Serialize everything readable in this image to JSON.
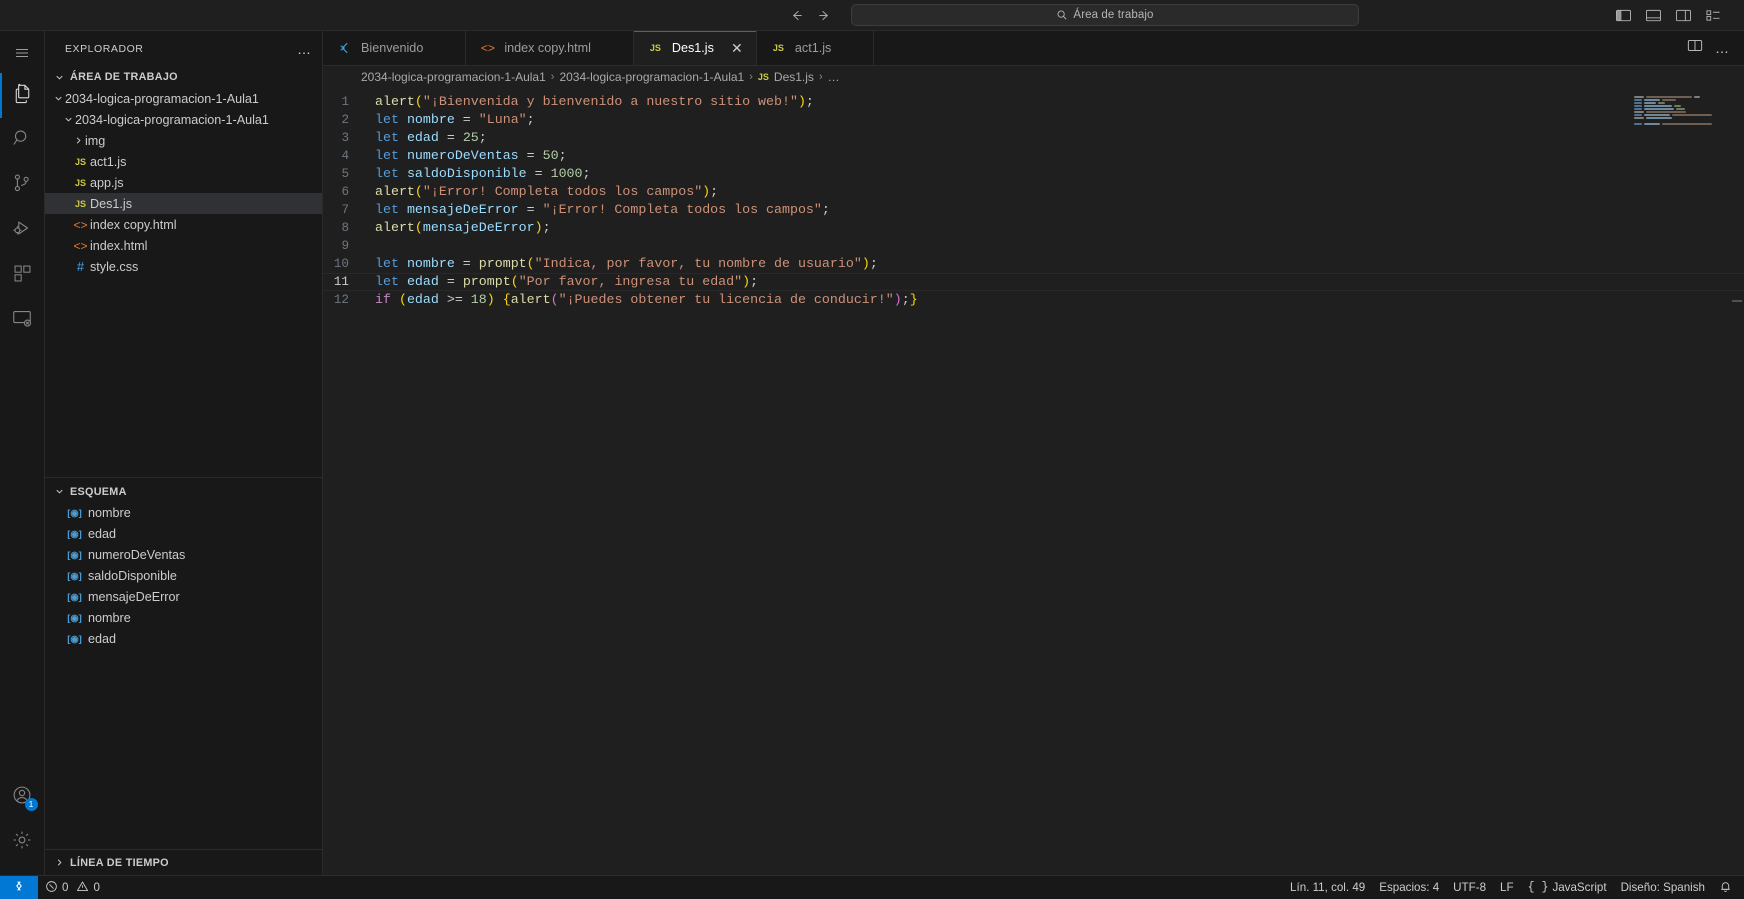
{
  "titlebar": {
    "back_icon": "arrow-left-icon",
    "forward_icon": "arrow-right-icon",
    "search_icon": "search-icon",
    "quick_input_label": "Área de trabajo",
    "layout_icons": [
      "toggle-primary-sidebar-icon",
      "toggle-panel-icon",
      "toggle-secondary-sidebar-icon",
      "customize-layout-icon"
    ]
  },
  "activitybar": {
    "items": [
      {
        "name": "menu-hamburger",
        "icon": "hamburger-icon"
      },
      {
        "name": "explorer",
        "icon": "files-icon",
        "active": true
      },
      {
        "name": "search",
        "icon": "search-icon"
      },
      {
        "name": "source-control",
        "icon": "source-control-icon"
      },
      {
        "name": "run-and-debug",
        "icon": "run-debug-icon"
      },
      {
        "name": "extensions",
        "icon": "extensions-icon"
      },
      {
        "name": "remote-explorer",
        "icon": "remote-explorer-icon"
      }
    ],
    "accounts": {
      "icon": "account-icon",
      "badge": "1"
    },
    "settings": {
      "icon": "gear-icon"
    }
  },
  "sidebar": {
    "title": "EXPLORADOR",
    "more_actions": "…",
    "workspace_section": "ÁREA DE TRABAJO",
    "tree": [
      {
        "label": "2034-logica-programacion-1-Aula1",
        "type": "folder",
        "indent": 1,
        "expanded": true
      },
      {
        "label": "2034-logica-programacion-1-Aula1",
        "type": "folder",
        "indent": 2,
        "expanded": true
      },
      {
        "label": "img",
        "type": "folder",
        "indent": 3,
        "expanded": false
      },
      {
        "label": "act1.js",
        "type": "js",
        "indent": 3
      },
      {
        "label": "app.js",
        "type": "js",
        "indent": 3
      },
      {
        "label": "Des1.js",
        "type": "js",
        "indent": 3,
        "selected": true
      },
      {
        "label": "index copy.html",
        "type": "html",
        "indent": 3
      },
      {
        "label": "index.html",
        "type": "html",
        "indent": 3
      },
      {
        "label": "style.css",
        "type": "css",
        "indent": 3
      }
    ],
    "outline_section": "ESQUEMA",
    "outline": [
      {
        "label": "nombre",
        "kind": "variable"
      },
      {
        "label": "edad",
        "kind": "variable"
      },
      {
        "label": "numeroDeVentas",
        "kind": "variable"
      },
      {
        "label": "saldoDisponible",
        "kind": "variable"
      },
      {
        "label": "mensajeDeError",
        "kind": "variable"
      },
      {
        "label": "nombre",
        "kind": "variable"
      },
      {
        "label": "edad",
        "kind": "variable"
      }
    ],
    "timeline_section": "LÍNEA DE TIEMPO"
  },
  "tabs": [
    {
      "label": "Bienvenido",
      "icon": "vscode-logo-icon",
      "active": false,
      "closable": false
    },
    {
      "label": "index copy.html",
      "icon": "html-icon",
      "active": false,
      "closable": false
    },
    {
      "label": "Des1.js",
      "icon": "js-icon",
      "active": true,
      "closable": true,
      "close_glyph": "✕"
    },
    {
      "label": "act1.js",
      "icon": "js-icon",
      "active": false,
      "closable": false
    }
  ],
  "editor_actions": [
    {
      "name": "split-editor-right-icon",
      "glyph": "split"
    },
    {
      "name": "more-actions-icon",
      "glyph": "…"
    }
  ],
  "breadcrumbs": [
    {
      "label": "2034-logica-programacion-1-Aula1",
      "icon": null
    },
    {
      "label": "2034-logica-programacion-1-Aula1",
      "icon": null
    },
    {
      "label": "Des1.js",
      "icon": "js-icon"
    },
    {
      "label": "…",
      "icon": null
    }
  ],
  "code": {
    "language": "javascript",
    "current_line": 11,
    "lines": [
      {
        "n": 1,
        "tokens": [
          {
            "t": "alert",
            "c": "fn"
          },
          {
            "t": "(",
            "c": "par2"
          },
          {
            "t": "\"¡Bienvenida y bienvenido a nuestro sitio web!\"",
            "c": "str"
          },
          {
            "t": ")",
            "c": "par2"
          },
          {
            "t": ";",
            "c": "pun"
          }
        ]
      },
      {
        "n": 2,
        "tokens": [
          {
            "t": "let",
            "c": "kw"
          },
          {
            "t": " ",
            "c": "pun"
          },
          {
            "t": "nombre",
            "c": "var"
          },
          {
            "t": " = ",
            "c": "pun"
          },
          {
            "t": "\"Luna\"",
            "c": "str"
          },
          {
            "t": ";",
            "c": "pun"
          }
        ]
      },
      {
        "n": 3,
        "tokens": [
          {
            "t": "let",
            "c": "kw"
          },
          {
            "t": " ",
            "c": "pun"
          },
          {
            "t": "edad",
            "c": "var"
          },
          {
            "t": " = ",
            "c": "pun"
          },
          {
            "t": "25",
            "c": "num"
          },
          {
            "t": ";",
            "c": "pun"
          }
        ]
      },
      {
        "n": 4,
        "tokens": [
          {
            "t": "let",
            "c": "kw"
          },
          {
            "t": " ",
            "c": "pun"
          },
          {
            "t": "numeroDeVentas",
            "c": "var"
          },
          {
            "t": " = ",
            "c": "pun"
          },
          {
            "t": "50",
            "c": "num"
          },
          {
            "t": ";",
            "c": "pun"
          }
        ]
      },
      {
        "n": 5,
        "tokens": [
          {
            "t": "let",
            "c": "kw"
          },
          {
            "t": " ",
            "c": "pun"
          },
          {
            "t": "saldoDisponible",
            "c": "var"
          },
          {
            "t": " = ",
            "c": "pun"
          },
          {
            "t": "1000",
            "c": "num"
          },
          {
            "t": ";",
            "c": "pun"
          }
        ]
      },
      {
        "n": 6,
        "tokens": [
          {
            "t": "alert",
            "c": "fn"
          },
          {
            "t": "(",
            "c": "par2"
          },
          {
            "t": "\"¡Error! Completa todos los campos\"",
            "c": "str"
          },
          {
            "t": ")",
            "c": "par2"
          },
          {
            "t": ";",
            "c": "pun"
          }
        ]
      },
      {
        "n": 7,
        "tokens": [
          {
            "t": "let",
            "c": "kw"
          },
          {
            "t": " ",
            "c": "pun"
          },
          {
            "t": "mensajeDeError",
            "c": "var"
          },
          {
            "t": " = ",
            "c": "pun"
          },
          {
            "t": "\"¡Error! Completa todos los campos\"",
            "c": "str"
          },
          {
            "t": ";",
            "c": "pun"
          }
        ]
      },
      {
        "n": 8,
        "tokens": [
          {
            "t": "alert",
            "c": "fn"
          },
          {
            "t": "(",
            "c": "par2"
          },
          {
            "t": "mensajeDeError",
            "c": "var"
          },
          {
            "t": ")",
            "c": "par2"
          },
          {
            "t": ";",
            "c": "pun"
          }
        ]
      },
      {
        "n": 9,
        "tokens": []
      },
      {
        "n": 10,
        "tokens": [
          {
            "t": "let",
            "c": "kw"
          },
          {
            "t": " ",
            "c": "pun"
          },
          {
            "t": "nombre",
            "c": "var"
          },
          {
            "t": " = ",
            "c": "pun"
          },
          {
            "t": "prompt",
            "c": "fn"
          },
          {
            "t": "(",
            "c": "par2"
          },
          {
            "t": "\"Indica, por favor, tu nombre de usuario\"",
            "c": "str"
          },
          {
            "t": ")",
            "c": "par2"
          },
          {
            "t": ";",
            "c": "pun"
          }
        ]
      },
      {
        "n": 11,
        "tokens": [
          {
            "t": "let",
            "c": "kw"
          },
          {
            "t": " ",
            "c": "pun"
          },
          {
            "t": "edad",
            "c": "var"
          },
          {
            "t": " = ",
            "c": "pun"
          },
          {
            "t": "prompt",
            "c": "fn"
          },
          {
            "t": "(",
            "c": "par2"
          },
          {
            "t": "\"Por favor, ingresa tu edad\"",
            "c": "str"
          },
          {
            "t": ")",
            "c": "par2"
          },
          {
            "t": ";",
            "c": "pun"
          }
        ]
      },
      {
        "n": 12,
        "tokens": [
          {
            "t": "if",
            "c": "kwc"
          },
          {
            "t": " ",
            "c": "pun"
          },
          {
            "t": "(",
            "c": "par2"
          },
          {
            "t": "edad",
            "c": "var"
          },
          {
            "t": " >= ",
            "c": "pun"
          },
          {
            "t": "18",
            "c": "num"
          },
          {
            "t": ")",
            "c": "par2"
          },
          {
            "t": " ",
            "c": "pun"
          },
          {
            "t": "{",
            "c": "par2"
          },
          {
            "t": "alert",
            "c": "fn"
          },
          {
            "t": "(",
            "c": "par"
          },
          {
            "t": "\"¡Puedes obtener tu licencia de conducir!\"",
            "c": "str"
          },
          {
            "t": ")",
            "c": "par"
          },
          {
            "t": ";",
            "c": "pun"
          },
          {
            "t": "}",
            "c": "par2"
          }
        ]
      }
    ]
  },
  "statusbar": {
    "remote_icon": "remote-window-icon",
    "errors_icon": "error-icon",
    "errors": "0",
    "warnings_icon": "warning-icon",
    "warnings": "0",
    "cursor_position": "Lín. 11, col. 49",
    "indentation": "Espacios: 4",
    "encoding": "UTF-8",
    "eol": "LF",
    "language_icon": "braces-icon",
    "language": "JavaScript",
    "layout": "Diseño: Spanish",
    "notifications_icon": "bell-icon"
  }
}
